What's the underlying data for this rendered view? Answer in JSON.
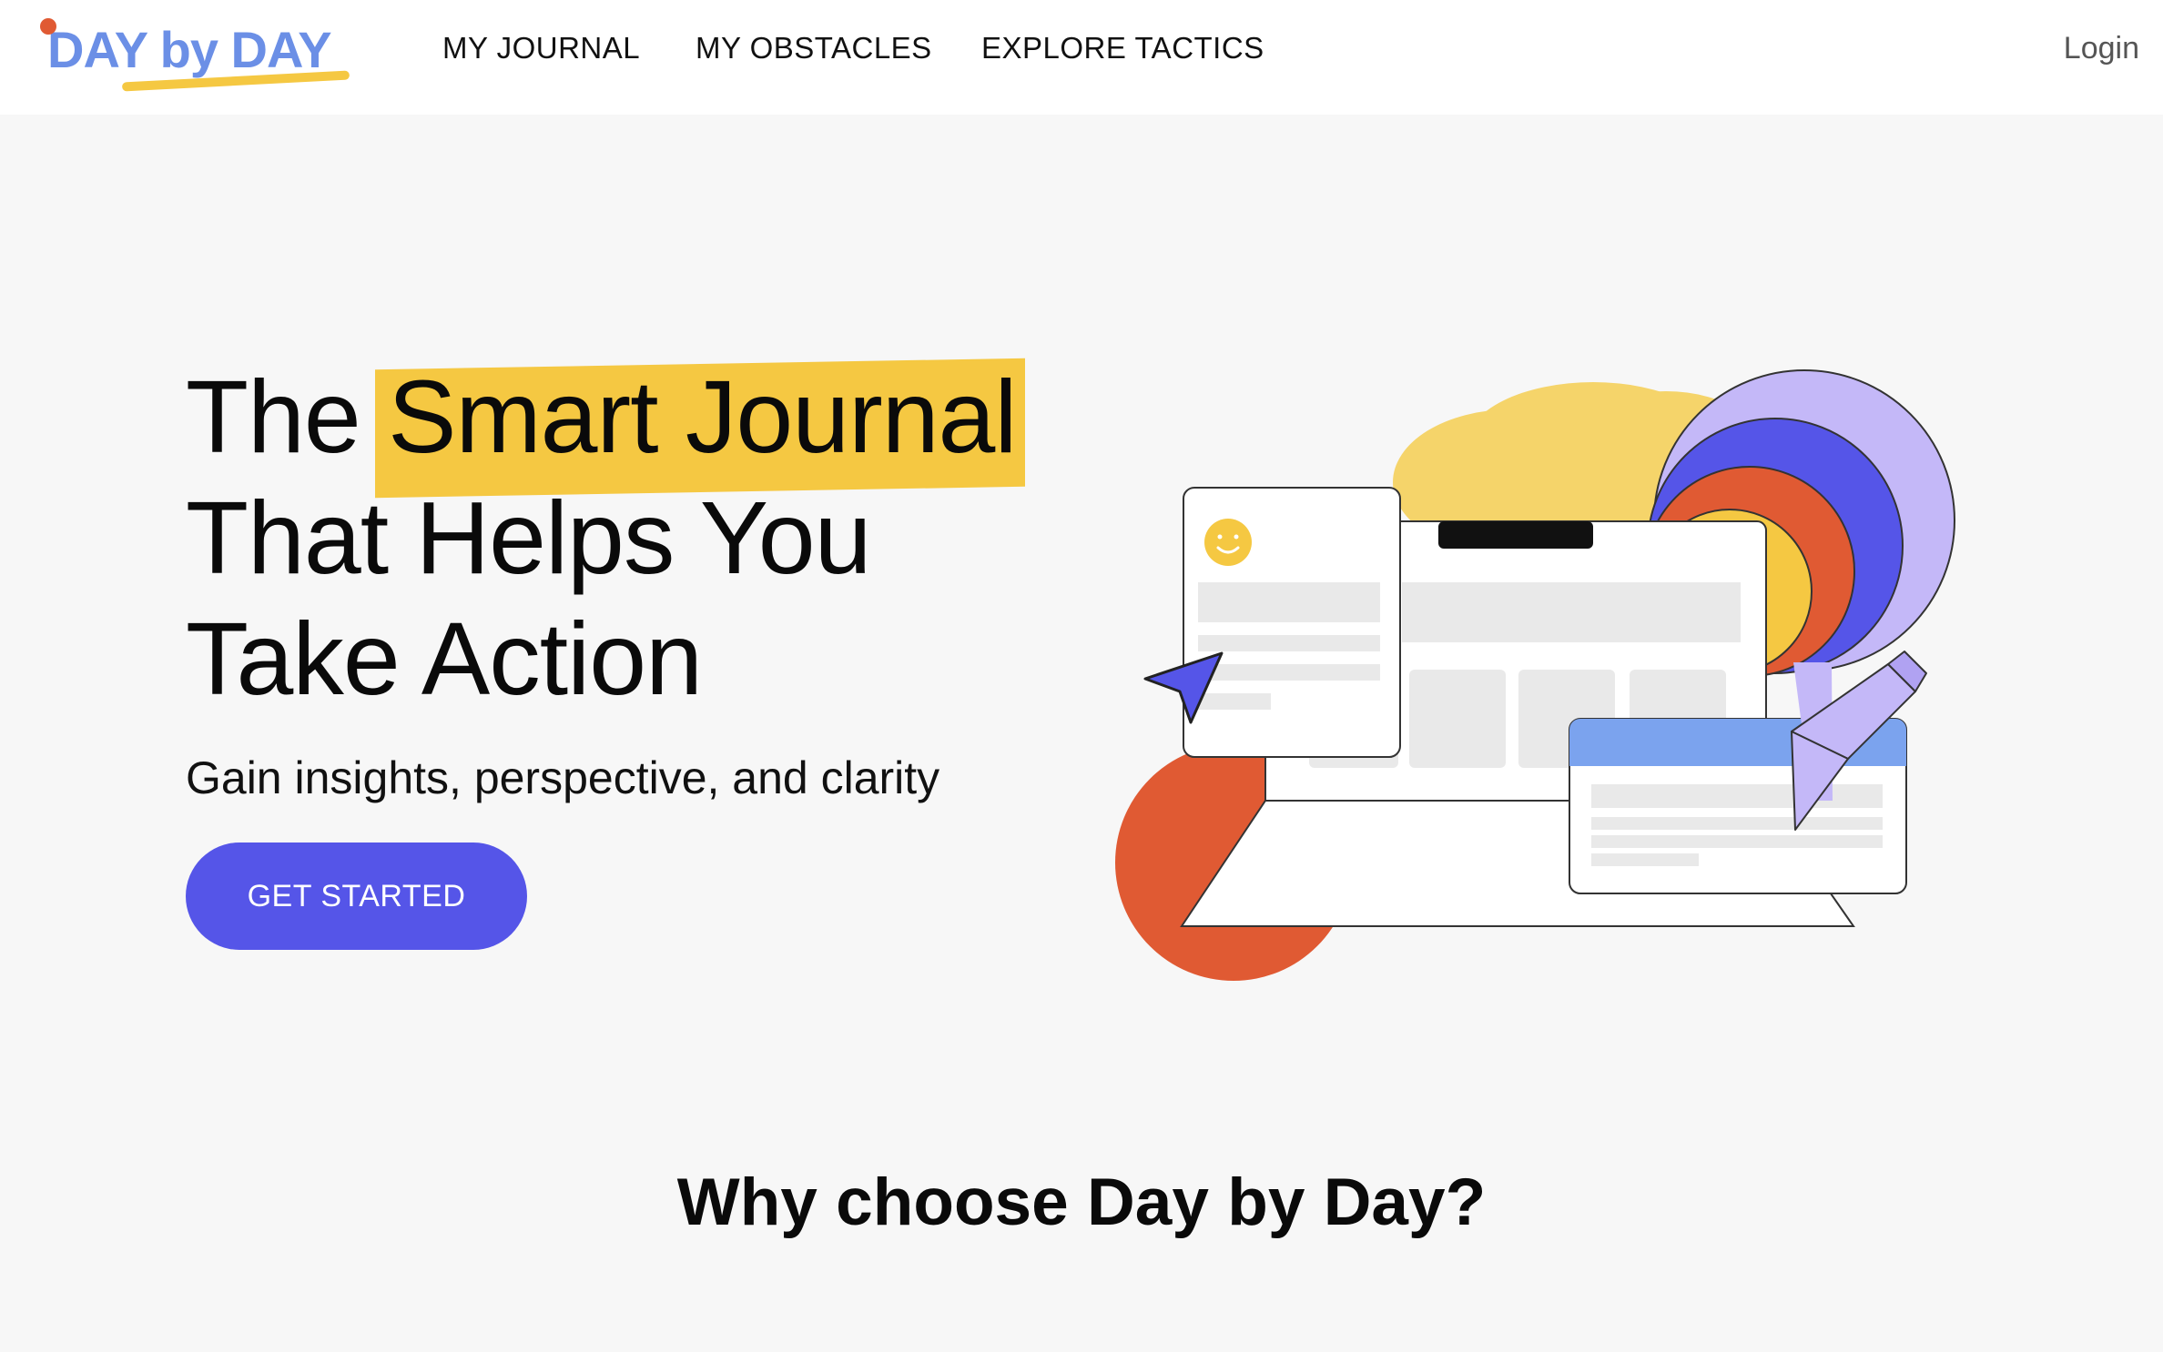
{
  "header": {
    "logo_text": "DAY by DAY",
    "nav": [
      {
        "label": "MY JOURNAL"
      },
      {
        "label": "MY OBSTACLES"
      },
      {
        "label": "EXPLORE TACTICS"
      }
    ],
    "login_label": "Login"
  },
  "hero": {
    "title_prefix": "The",
    "title_highlight": "Smart Journal",
    "title_line2": "That Helps You",
    "title_line3": "Take Action",
    "subtitle": "Gain insights, perspective, and clarity",
    "cta_label": "GET STARTED"
  },
  "section": {
    "title": "Why choose Day by Day?"
  },
  "colors": {
    "accent": "#5555e8",
    "highlight": "#f5c842",
    "logo": "#6b8fe6",
    "orange": "#e05a33",
    "lavender": "#c4b8f8",
    "background": "#f7f7f7"
  },
  "icons": [
    "smiley-icon",
    "cursor-arrow-icon",
    "pencil-icon"
  ]
}
